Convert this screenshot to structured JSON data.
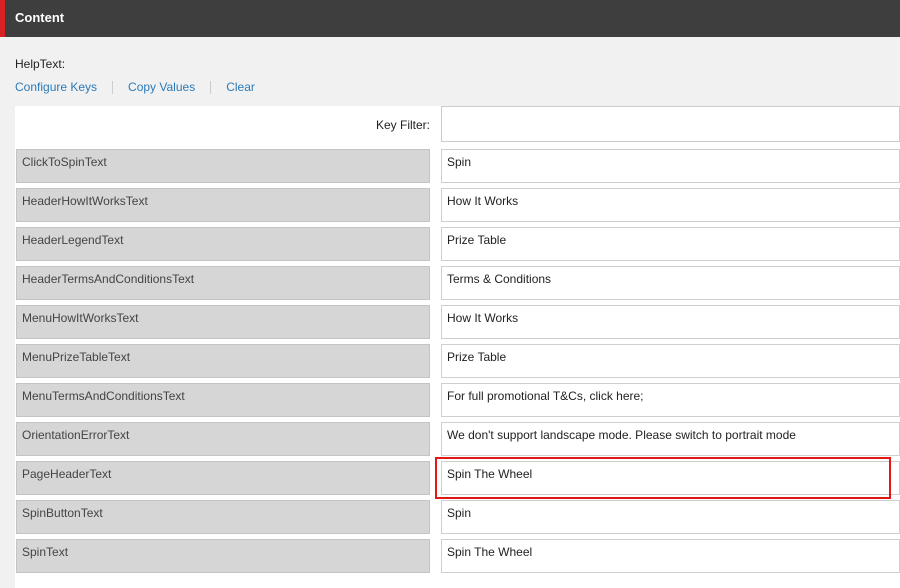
{
  "header": {
    "title": "Content"
  },
  "help_text": "HelpText:",
  "links": {
    "configure_keys": "Configure Keys",
    "copy_values": "Copy Values",
    "clear": "Clear"
  },
  "filter": {
    "label": "Key Filter:",
    "value": ""
  },
  "rows": [
    {
      "key": "ClickToSpinText",
      "value": "Spin"
    },
    {
      "key": "HeaderHowItWorksText",
      "value": "How It Works"
    },
    {
      "key": "HeaderLegendText",
      "value": "Prize Table"
    },
    {
      "key": "HeaderTermsAndConditionsText",
      "value": "Terms & Conditions"
    },
    {
      "key": "MenuHowItWorksText",
      "value": "How It Works"
    },
    {
      "key": "MenuPrizeTableText",
      "value": "Prize Table"
    },
    {
      "key": "MenuTermsAndConditionsText",
      "value": "For full promotional T&Cs, click here;"
    },
    {
      "key": "OrientationErrorText",
      "value": "We don't support landscape mode. Please switch to portrait mode"
    },
    {
      "key": "PageHeaderText",
      "value": "Spin The Wheel"
    },
    {
      "key": "SpinButtonText",
      "value": "Spin"
    },
    {
      "key": "SpinText",
      "value": "Spin The Wheel"
    }
  ],
  "colors": {
    "accent": "#d62222",
    "link": "#2b7bb9",
    "highlight": "#e01818"
  }
}
